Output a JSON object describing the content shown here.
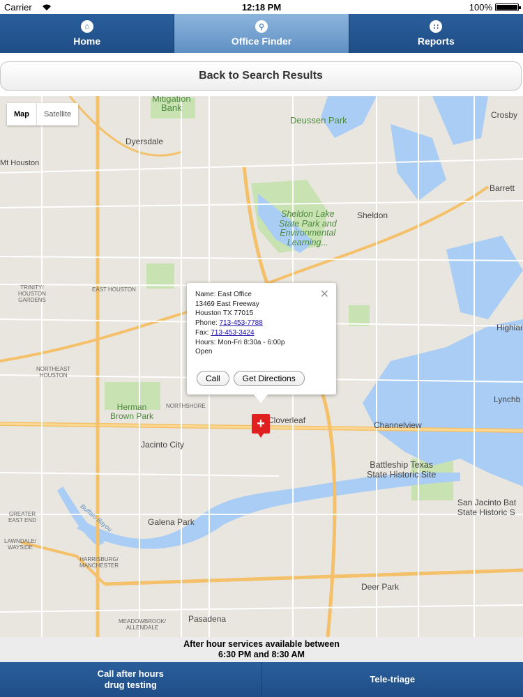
{
  "status_bar": {
    "carrier": "Carrier",
    "time": "12:18 PM",
    "battery": "100%"
  },
  "tabs": [
    {
      "label": "Home",
      "icon": "home-icon"
    },
    {
      "label": "Office Finder",
      "icon": "search-icon",
      "active": true
    },
    {
      "label": "Reports",
      "icon": "grid-icon"
    }
  ],
  "back_button": "Back to Search Results",
  "map": {
    "type_controls": {
      "map": "Map",
      "satellite": "Satellite"
    },
    "labels": {
      "mitigation_bank": "Mitigation\nBank",
      "deussen_park": "Deussen Park",
      "crosby": "Crosby",
      "dyersdale": "Dyersdale",
      "mt_houston": "Mt Houston",
      "sheldon_lake": "Sheldon Lake\nState Park and\nEnvironmental\nLearning...",
      "sheldon": "Sheldon",
      "barrett": "Barrett",
      "trinity_houston_gardens": "TRINITY/\nHOUSTON\nGARDENS",
      "east_houston": "EAST HOUSTON",
      "northeast_houston": "NORTHEAST\nHOUSTON",
      "herman_brown_park": "Herman\nBrown Park",
      "northshore": "NORTHSHORE",
      "cloverleaf": "Cloverleaf",
      "channelview": "Channelview",
      "jacinto_city": "Jacinto City",
      "battleship_texas": "Battleship Texas\nState Historic Site",
      "san_jacinto": "San Jacinto Bat\nState Historic S",
      "galena_park": "Galena Park",
      "greater_east_end": "GREATER\nEAST END",
      "lawndale_wayside": "LAWNDALE/\nWAYSIDE",
      "harrisburg_manchester": "HARRISBURG/\nMANCHESTER",
      "deer_park": "Deer Park",
      "pasadena": "Pasadena",
      "meadowbrook": "MEADOWBROOK/\nALLENDALE",
      "lynchburg": "Lynchb",
      "highlands": "Highlan",
      "buffalo_bayou": "Buffalo Bayou"
    }
  },
  "popup": {
    "name": "Name: East Office",
    "address1": "13469 East Freeway",
    "address2": "Houston TX 77015",
    "phone_label": "Phone: ",
    "phone": "713-453-7788",
    "fax_label": "Fax: ",
    "fax": "713-453-3424",
    "hours": "Hours: Mon-Fri 8:30a - 6:00p",
    "status": "Open",
    "call_label": "Call",
    "directions_label": "Get Directions"
  },
  "notice": {
    "line1": "After hour services available between",
    "line2": "6:30 PM and 8:30 AM"
  },
  "bottom_bar": {
    "after_hours": "Call after hours\ndrug testing",
    "tele_triage": "Tele-triage"
  }
}
